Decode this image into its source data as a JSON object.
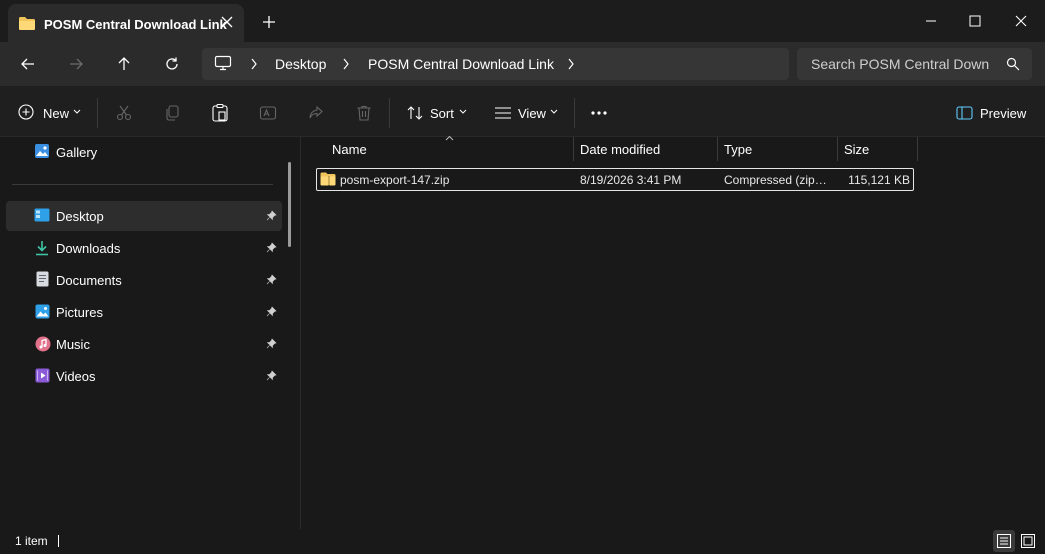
{
  "window": {
    "tab_title": "POSM Central Download Link"
  },
  "breadcrumb": {
    "items": [
      "Desktop",
      "POSM Central Download Link"
    ]
  },
  "search": {
    "placeholder": "Search POSM Central Download Link"
  },
  "toolbar": {
    "new_label": "New",
    "sort_label": "Sort",
    "view_label": "View",
    "preview_label": "Preview"
  },
  "sidebar": {
    "gallery_label": "Gallery",
    "items": [
      {
        "label": "Desktop",
        "icon": "desktop-icon"
      },
      {
        "label": "Downloads",
        "icon": "download-icon"
      },
      {
        "label": "Documents",
        "icon": "document-icon"
      },
      {
        "label": "Pictures",
        "icon": "pictures-icon"
      },
      {
        "label": "Music",
        "icon": "music-icon"
      },
      {
        "label": "Videos",
        "icon": "videos-icon"
      }
    ]
  },
  "table": {
    "columns": [
      "Name",
      "Date modified",
      "Type",
      "Size"
    ],
    "rows": [
      {
        "name": "posm-export-147.zip",
        "date": "8/19/2026 3:41 PM",
        "type": "Compressed (zipped) Folder",
        "size": "115,121 KB"
      }
    ]
  },
  "status": {
    "item_count": "1 item"
  },
  "colors": {
    "folder": "#f2c55c",
    "selection": "#2d2d2d",
    "accent": "#60cdff"
  }
}
